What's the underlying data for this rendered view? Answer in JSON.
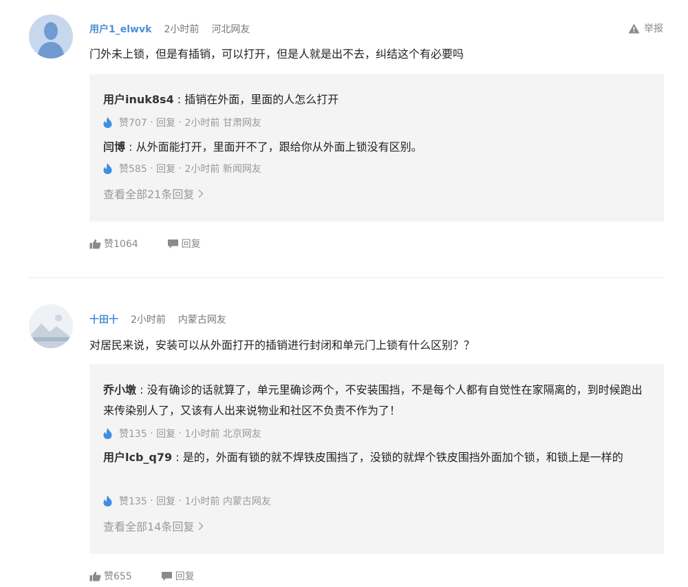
{
  "comments": [
    {
      "user": "用户1_elwvk",
      "time": "2小时前",
      "location": "河北网友",
      "report": "举报",
      "text": "门外未上锁，但是有插销，可以打开，但是人就是出不去，纠结这个有必要吗",
      "replies": [
        {
          "name": "用户inuk8s4",
          "sep": " : ",
          "text": "插销在外面，里面的人怎么打开",
          "likes": "赞707",
          "reply": "回复",
          "time": "2小时前",
          "location": "甘肃网友"
        },
        {
          "name": "闫博",
          "sep": " : ",
          "text": "从外面能打开，里面开不了，跟给你从外面上锁没有区别。",
          "likes": "赞585",
          "reply": "回复",
          "time": "2小时前",
          "location": "新闻网友"
        }
      ],
      "more": "查看全部21条回复",
      "like_label": "赞1064",
      "reply_label": "回复"
    },
    {
      "user": "十田十",
      "time": "2小时前",
      "location": "内蒙古网友",
      "text": "对居民来说，安装可以从外面打开的插销进行封闭和单元门上锁有什么区别？？",
      "replies": [
        {
          "name": "乔小墩",
          "sep": " : ",
          "text": "没有确诊的话就算了，单元里确诊两个，不安装围挡，不是每个人都有自觉性在家隔离的，到时候跑出来传染别人了，又该有人出来说物业和社区不负责不作为了！",
          "likes": "赞135",
          "reply": "回复",
          "time": "1小时前",
          "location": "北京网友"
        },
        {
          "name": "用户lcb_q79",
          "sep": " : ",
          "text": "是的，外面有锁的就不焊铁皮围挡了，没锁的就焊个铁皮围挡外面加个锁，和锁上是一样的",
          "likes": "赞135",
          "reply": "回复",
          "time": "1小时前",
          "location": "内蒙古网友"
        }
      ],
      "more": "查看全部14条回复",
      "like_label": "赞655",
      "reply_label": "回复"
    }
  ],
  "colors": {
    "username": "#4c8fd6",
    "reply_bg": "#f4f4f4",
    "flame": "#3d8fe6"
  }
}
